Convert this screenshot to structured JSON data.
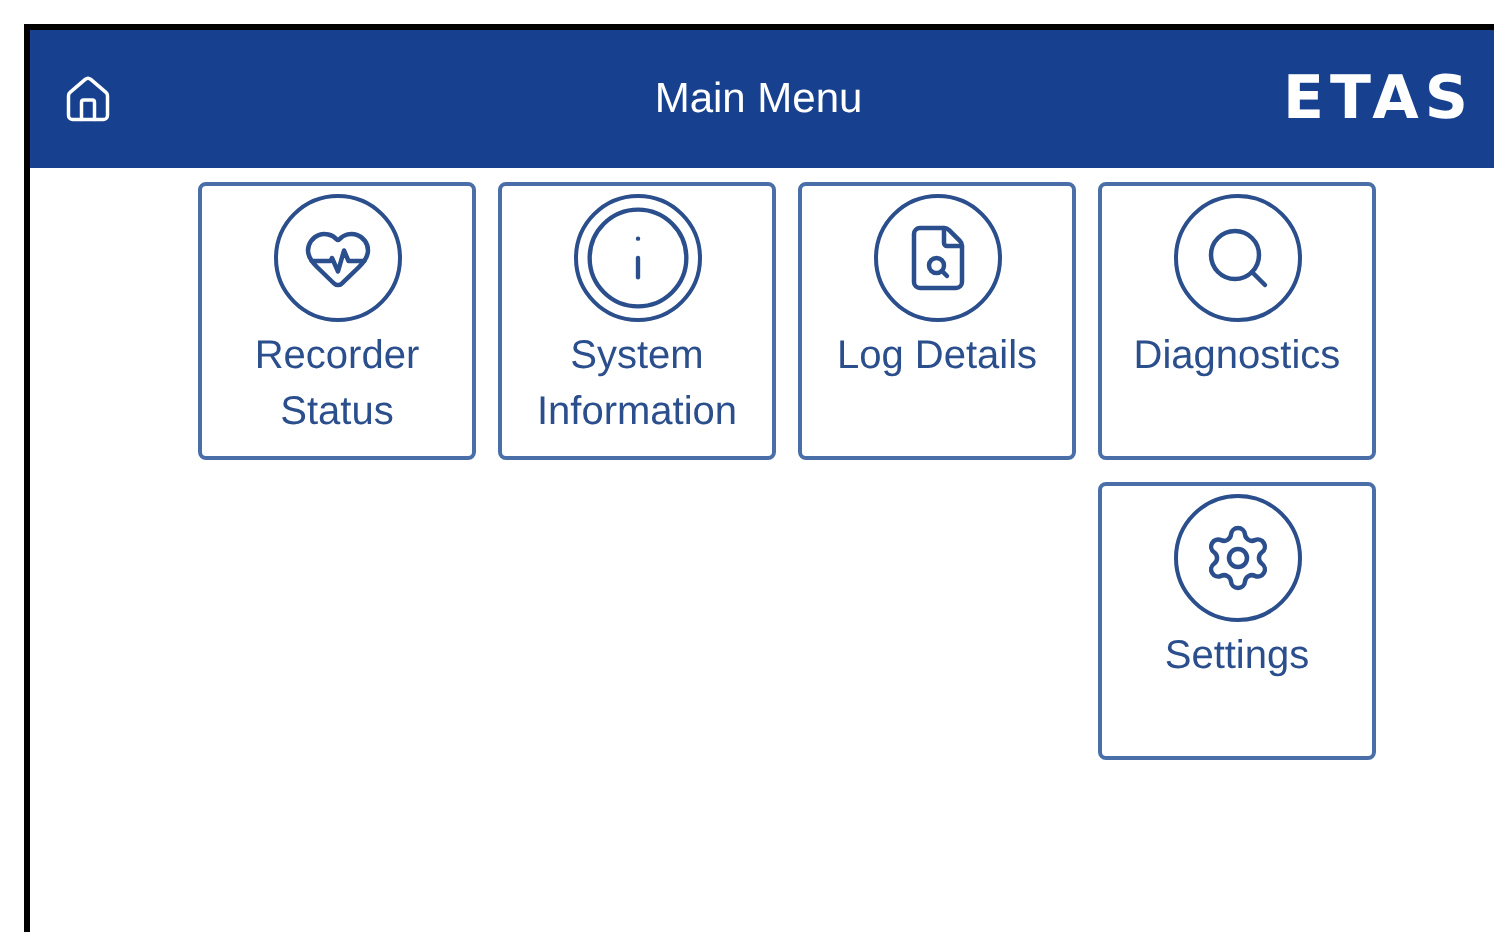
{
  "header": {
    "title": "Main Menu",
    "logo": "ETAS"
  },
  "tiles": [
    {
      "label": "Recorder Status",
      "kind": "status"
    },
    {
      "label": "System Information",
      "kind": "info"
    },
    {
      "label": "Log Details",
      "kind": "log"
    },
    {
      "label": "Diagnostics",
      "kind": "diagnostics"
    },
    {
      "label": "Settings",
      "kind": "settings"
    }
  ]
}
